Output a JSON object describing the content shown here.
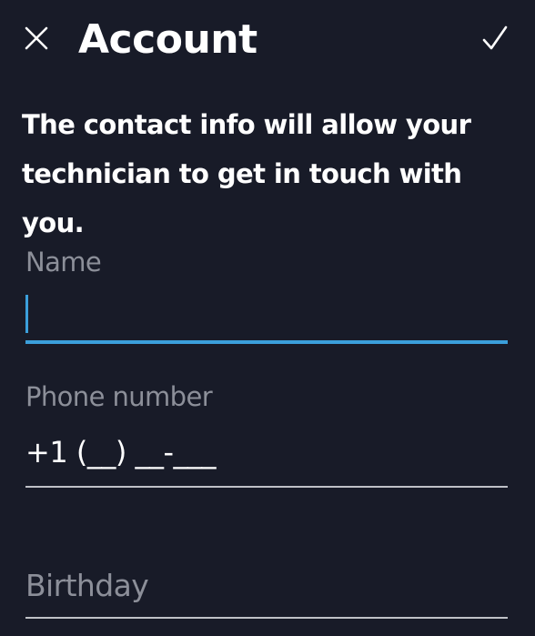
{
  "app_bar": {
    "close_icon": "close-icon",
    "title": "Account",
    "confirm_icon": "checkmark-icon"
  },
  "intro_text": "The contact info will allow your technician to get in touch with you.",
  "form": {
    "name": {
      "label": "Name",
      "value": ""
    },
    "phone": {
      "label": "Phone number",
      "value": "+1 (__) __-___"
    },
    "birthday": {
      "label": "Birthday",
      "value": ""
    }
  },
  "colors": {
    "background": "#181b28",
    "accent": "#3b9fdb",
    "label_gray": "#8c8f99",
    "divider": "#bfc1c7",
    "text": "#ffffff"
  }
}
